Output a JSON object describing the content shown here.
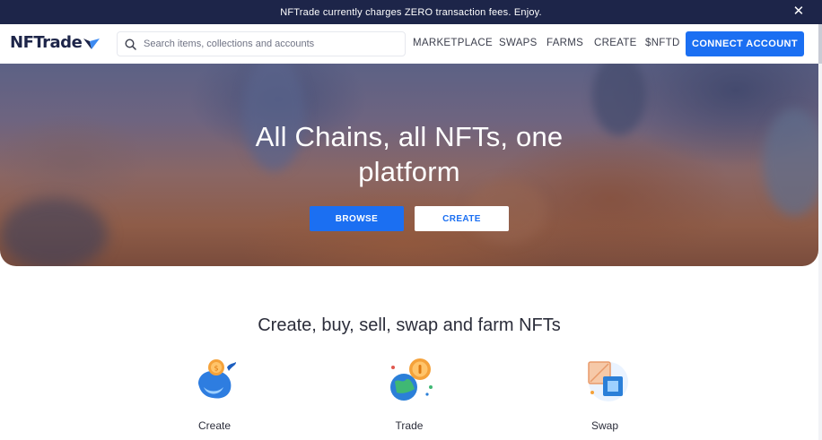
{
  "announcement": {
    "text": "NFTrade currently charges ZERO transaction fees. Enjoy.",
    "close_icon": "close-icon"
  },
  "header": {
    "logo_text": "NFTrade",
    "logo_icon": "nftrade-logo-mark",
    "search": {
      "placeholder": "Search items, collections and accounts",
      "value": "",
      "icon": "search-icon"
    },
    "nav": [
      "MARKETPLACE",
      "SWAPS",
      "FARMS",
      "CREATE",
      "$NFTD"
    ],
    "connect_label": "CONNECT ACCOUNT"
  },
  "hero": {
    "title_line1": "All Chains, all NFTs, one",
    "title_line2": "platform",
    "browse_label": "BROWSE",
    "create_label": "CREATE"
  },
  "features": {
    "title": "Create, buy, sell, swap and farm NFTs",
    "items": [
      {
        "label": "Create",
        "icon": "whale-coin-icon"
      },
      {
        "label": "Trade",
        "icon": "globe-coin-icon"
      },
      {
        "label": "Swap",
        "icon": "swap-cubes-icon"
      }
    ]
  },
  "colors": {
    "announcement_bg": "#1d2549",
    "brand_blue": "#1b6ff2",
    "logo_navy": "#1d2549",
    "text_dark": "#2b2d3a"
  }
}
